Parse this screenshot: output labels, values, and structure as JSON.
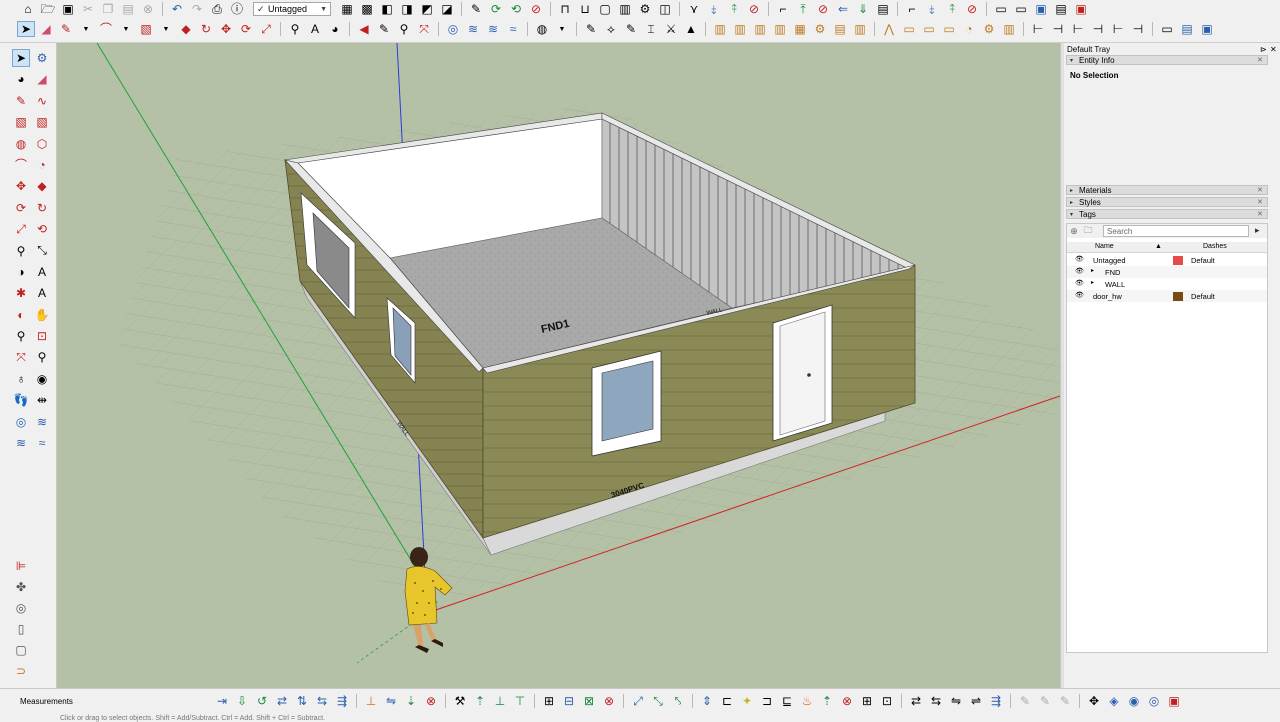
{
  "colors": {
    "viewport_bg": "#b5c1a6",
    "siding": "#8d8a58",
    "axis_red": "#d21f1f",
    "axis_green": "#1ea23a",
    "axis_blue": "#2a3ee0",
    "selection": "#cde4f7",
    "tag_untagged_color": "#e64a4a",
    "tag_door_hw_color": "#7a4a10"
  },
  "toolbar_top": {
    "row1_icons": [
      "home-icon",
      "folder-open-icon",
      "save-icon",
      "cut-icon",
      "copy-icon",
      "paste-icon",
      "erase-icon",
      "undo-icon",
      "redo-icon",
      "print-icon",
      "info-icon"
    ],
    "tag_dropdown": {
      "value": "Untagged"
    },
    "row1_right_icons": [
      "component-icon",
      "group-icon",
      "solid-icon",
      "union-icon",
      "subtract-icon",
      "trim-icon",
      "intersect-icon",
      "pencil-icon",
      "paint-icon",
      "flip-icon",
      "settings-icon",
      "sandbox-icon",
      "smoove-icon",
      "stamp-icon",
      "drape-icon",
      "grid-icon",
      "flip-edge-icon",
      "add-detail-icon",
      "sandbox-contour-icon"
    ],
    "row2_icons": [
      "select-icon",
      "eraser-icon",
      "line-icon",
      "arc-icon",
      "rectangle-icon",
      "push-pull-icon",
      "move-icon",
      "rotate-icon",
      "scale-icon",
      "tape-icon",
      "text-icon",
      "paint-bucket-icon",
      "section-plane-icon",
      "walk-icon",
      "look-around-icon",
      "orbit-icon",
      "pan-icon",
      "zoom-icon",
      "zoom-extents-icon",
      "zoom-window-icon",
      "iso-view-icon",
      "top-view-icon",
      "front-view-icon",
      "right-view-icon",
      "back-view-icon",
      "left-view-icon",
      "xray-icon",
      "wireframe-icon",
      "hidden-line-icon",
      "shaded-icon",
      "textured-icon",
      "monochrome-icon",
      "wall-icon",
      "window-icon",
      "door-icon",
      "roof-icon",
      "floor-icon",
      "stair-icon",
      "foundation-icon",
      "gear-icon",
      "layers-icon",
      "truss-icon",
      "rafter-icon",
      "joist-icon",
      "beam-icon",
      "column-icon",
      "header-icon",
      "estimate-icon"
    ]
  },
  "left_toolbar": {
    "icons": [
      "select-icon",
      "component-icon",
      "paint-bucket-icon",
      "eraser-icon",
      "line-icon",
      "freehand-icon",
      "rectangle-icon",
      "rotated-rectangle-icon",
      "circle-icon",
      "polygon-icon",
      "arc-icon",
      "pie-icon",
      "move-icon",
      "push-pull-icon",
      "rotate-icon",
      "follow-me-icon",
      "scale-icon",
      "offset-icon",
      "tape-measure-icon",
      "dimension-icon",
      "protractor-icon",
      "text-icon",
      "axes-icon",
      "3d-text-icon",
      "orbit-icon",
      "pan-icon",
      "zoom-icon",
      "zoom-window-icon",
      "zoom-extents-icon",
      "previous-view-icon",
      "position-camera-icon",
      "look-around-icon",
      "walk-icon",
      "section-plane-icon",
      "sandbox-from-contours-icon",
      "sandbox-scratch-icon",
      "smoove-icon",
      "stamp-icon"
    ],
    "extra_icons": [
      "ruler-icon",
      "fan-icon",
      "target-icon",
      "clip-icon",
      "lock-icon",
      "bucket-icon",
      "grid-icon"
    ]
  },
  "viewport": {
    "labels": {
      "floor": "FND1",
      "front_wall": "3040PVC",
      "top_label": "WALL",
      "side_label": "WALL"
    }
  },
  "tray": {
    "title": "Default Tray",
    "entity_info": {
      "title": "Entity Info",
      "selection": "No Selection"
    },
    "panels": [
      {
        "label": "Materials",
        "expanded": false
      },
      {
        "label": "Styles",
        "expanded": false
      },
      {
        "label": "Tags",
        "expanded": true
      }
    ],
    "tags": {
      "search_placeholder": "Search",
      "col_name": "Name",
      "col_dashes": "Dashes",
      "rows": [
        {
          "name": "Untagged",
          "expand": "",
          "color": "#e64a4a",
          "dashes": "Default",
          "indent": 0
        },
        {
          "name": "FND",
          "expand": "▸",
          "color": "",
          "dashes": "",
          "indent": 1
        },
        {
          "name": "WALL",
          "expand": "▸",
          "color": "",
          "dashes": "",
          "indent": 1
        },
        {
          "name": "door_hw",
          "expand": "",
          "color": "#7a4a10",
          "dashes": "Default",
          "indent": 0
        }
      ]
    }
  },
  "status": {
    "measurements_label": "Measurements",
    "hint": "Click or drag to select objects. Shift = Add/Subtract. Ctrl = Add. Shift + Ctrl = Subtract."
  }
}
